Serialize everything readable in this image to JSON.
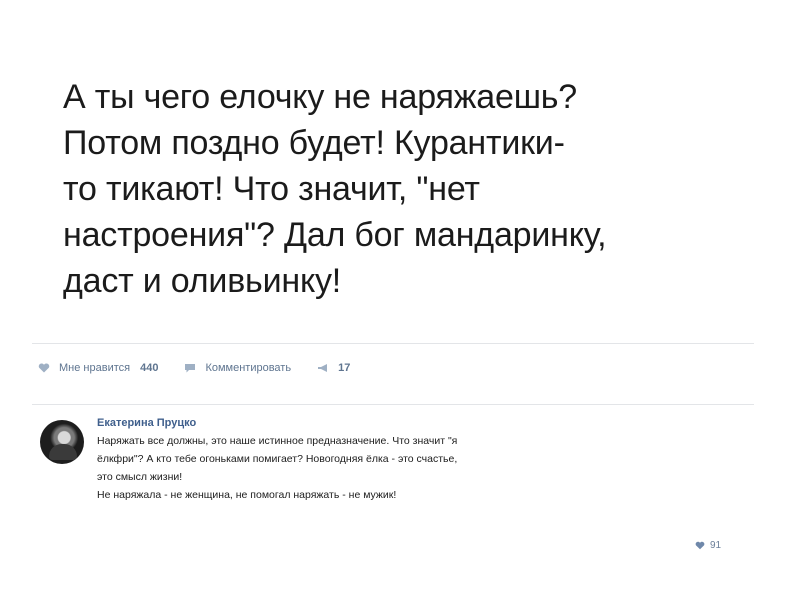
{
  "post": {
    "text_lines": [
      "А ты чего елочку не наряжаешь?",
      "Потом поздно будет! Курантики-",
      "то тикают! Что значит, \"нет",
      "настроения\"? Дал бог мандаринку,",
      "даст и оливьинку!"
    ]
  },
  "actions": {
    "like": {
      "label": "Мне нравится",
      "count": "440",
      "icon": "heart-icon"
    },
    "comment": {
      "label": "Комментировать",
      "icon": "comment-icon"
    },
    "share": {
      "label": "",
      "count": "17",
      "icon": "megaphone-icon"
    }
  },
  "comment": {
    "author": "Екатерина Пруцко",
    "lines": [
      "Наряжать все должны, это наше истинное предназначение. Что значит \"я",
      "ёлкфри\"? А кто тебе огоньками помигает? Новогодняя ёлка - это счастье,",
      "это смысл жизни!",
      "Не наряжала - не женщина, не помогал наряжать - не мужик!"
    ],
    "likes": "91",
    "icon": "heart-icon"
  },
  "colors": {
    "link": "#3f5f8c",
    "action": "#5f7590",
    "divider": "#e3e5e8"
  }
}
